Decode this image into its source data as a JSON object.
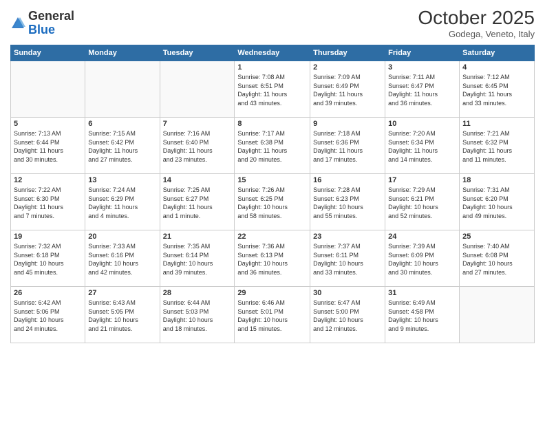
{
  "logo": {
    "general": "General",
    "blue": "Blue"
  },
  "header": {
    "month": "October 2025",
    "location": "Godega, Veneto, Italy"
  },
  "weekdays": [
    "Sunday",
    "Monday",
    "Tuesday",
    "Wednesday",
    "Thursday",
    "Friday",
    "Saturday"
  ],
  "weeks": [
    [
      {
        "day": "",
        "info": ""
      },
      {
        "day": "",
        "info": ""
      },
      {
        "day": "",
        "info": ""
      },
      {
        "day": "1",
        "info": "Sunrise: 7:08 AM\nSunset: 6:51 PM\nDaylight: 11 hours\nand 43 minutes."
      },
      {
        "day": "2",
        "info": "Sunrise: 7:09 AM\nSunset: 6:49 PM\nDaylight: 11 hours\nand 39 minutes."
      },
      {
        "day": "3",
        "info": "Sunrise: 7:11 AM\nSunset: 6:47 PM\nDaylight: 11 hours\nand 36 minutes."
      },
      {
        "day": "4",
        "info": "Sunrise: 7:12 AM\nSunset: 6:45 PM\nDaylight: 11 hours\nand 33 minutes."
      }
    ],
    [
      {
        "day": "5",
        "info": "Sunrise: 7:13 AM\nSunset: 6:44 PM\nDaylight: 11 hours\nand 30 minutes."
      },
      {
        "day": "6",
        "info": "Sunrise: 7:15 AM\nSunset: 6:42 PM\nDaylight: 11 hours\nand 27 minutes."
      },
      {
        "day": "7",
        "info": "Sunrise: 7:16 AM\nSunset: 6:40 PM\nDaylight: 11 hours\nand 23 minutes."
      },
      {
        "day": "8",
        "info": "Sunrise: 7:17 AM\nSunset: 6:38 PM\nDaylight: 11 hours\nand 20 minutes."
      },
      {
        "day": "9",
        "info": "Sunrise: 7:18 AM\nSunset: 6:36 PM\nDaylight: 11 hours\nand 17 minutes."
      },
      {
        "day": "10",
        "info": "Sunrise: 7:20 AM\nSunset: 6:34 PM\nDaylight: 11 hours\nand 14 minutes."
      },
      {
        "day": "11",
        "info": "Sunrise: 7:21 AM\nSunset: 6:32 PM\nDaylight: 11 hours\nand 11 minutes."
      }
    ],
    [
      {
        "day": "12",
        "info": "Sunrise: 7:22 AM\nSunset: 6:30 PM\nDaylight: 11 hours\nand 7 minutes."
      },
      {
        "day": "13",
        "info": "Sunrise: 7:24 AM\nSunset: 6:29 PM\nDaylight: 11 hours\nand 4 minutes."
      },
      {
        "day": "14",
        "info": "Sunrise: 7:25 AM\nSunset: 6:27 PM\nDaylight: 11 hours\nand 1 minute."
      },
      {
        "day": "15",
        "info": "Sunrise: 7:26 AM\nSunset: 6:25 PM\nDaylight: 10 hours\nand 58 minutes."
      },
      {
        "day": "16",
        "info": "Sunrise: 7:28 AM\nSunset: 6:23 PM\nDaylight: 10 hours\nand 55 minutes."
      },
      {
        "day": "17",
        "info": "Sunrise: 7:29 AM\nSunset: 6:21 PM\nDaylight: 10 hours\nand 52 minutes."
      },
      {
        "day": "18",
        "info": "Sunrise: 7:31 AM\nSunset: 6:20 PM\nDaylight: 10 hours\nand 49 minutes."
      }
    ],
    [
      {
        "day": "19",
        "info": "Sunrise: 7:32 AM\nSunset: 6:18 PM\nDaylight: 10 hours\nand 45 minutes."
      },
      {
        "day": "20",
        "info": "Sunrise: 7:33 AM\nSunset: 6:16 PM\nDaylight: 10 hours\nand 42 minutes."
      },
      {
        "day": "21",
        "info": "Sunrise: 7:35 AM\nSunset: 6:14 PM\nDaylight: 10 hours\nand 39 minutes."
      },
      {
        "day": "22",
        "info": "Sunrise: 7:36 AM\nSunset: 6:13 PM\nDaylight: 10 hours\nand 36 minutes."
      },
      {
        "day": "23",
        "info": "Sunrise: 7:37 AM\nSunset: 6:11 PM\nDaylight: 10 hours\nand 33 minutes."
      },
      {
        "day": "24",
        "info": "Sunrise: 7:39 AM\nSunset: 6:09 PM\nDaylight: 10 hours\nand 30 minutes."
      },
      {
        "day": "25",
        "info": "Sunrise: 7:40 AM\nSunset: 6:08 PM\nDaylight: 10 hours\nand 27 minutes."
      }
    ],
    [
      {
        "day": "26",
        "info": "Sunrise: 6:42 AM\nSunset: 5:06 PM\nDaylight: 10 hours\nand 24 minutes."
      },
      {
        "day": "27",
        "info": "Sunrise: 6:43 AM\nSunset: 5:05 PM\nDaylight: 10 hours\nand 21 minutes."
      },
      {
        "day": "28",
        "info": "Sunrise: 6:44 AM\nSunset: 5:03 PM\nDaylight: 10 hours\nand 18 minutes."
      },
      {
        "day": "29",
        "info": "Sunrise: 6:46 AM\nSunset: 5:01 PM\nDaylight: 10 hours\nand 15 minutes."
      },
      {
        "day": "30",
        "info": "Sunrise: 6:47 AM\nSunset: 5:00 PM\nDaylight: 10 hours\nand 12 minutes."
      },
      {
        "day": "31",
        "info": "Sunrise: 6:49 AM\nSunset: 4:58 PM\nDaylight: 10 hours\nand 9 minutes."
      },
      {
        "day": "",
        "info": ""
      }
    ]
  ]
}
